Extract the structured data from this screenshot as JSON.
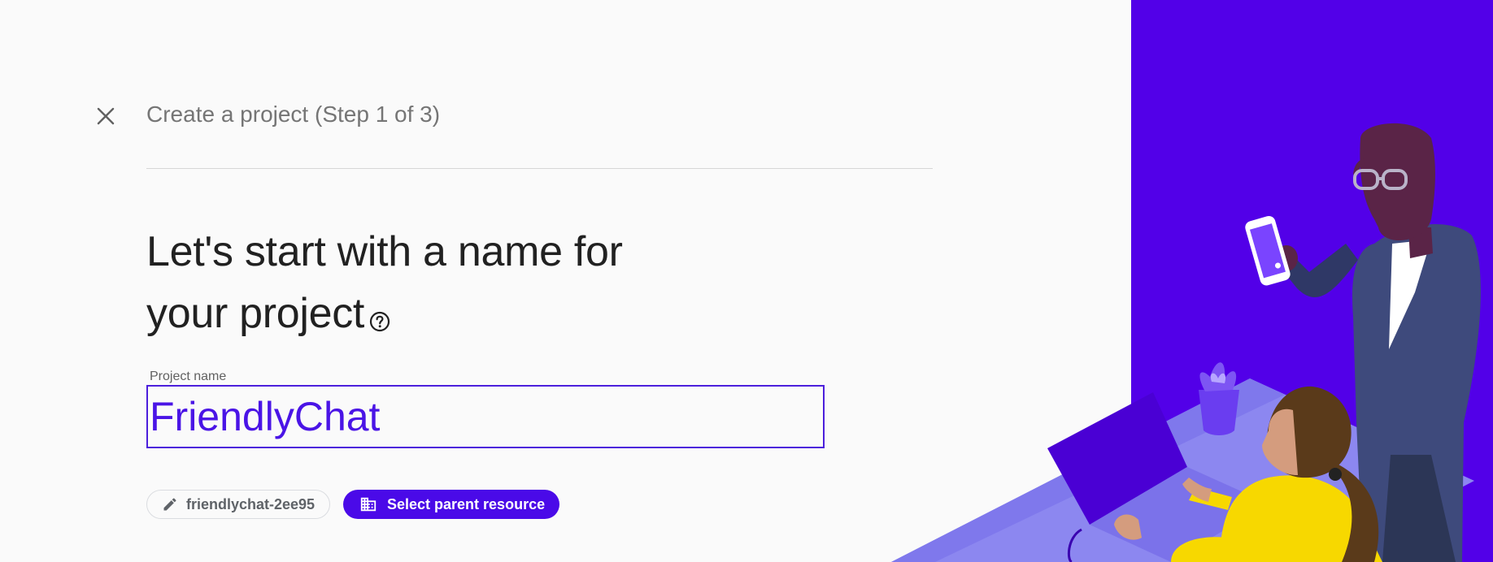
{
  "header": {
    "close_icon": "close-icon",
    "title": "Create a project (Step 1 of 3)"
  },
  "main": {
    "headline_line1": "Let's start with a name for",
    "headline_line2": "your project",
    "help_icon": "help-circle-icon",
    "project_name_label": "Project name",
    "project_name_value": "FriendlyChat"
  },
  "chips": {
    "project_id_icon": "pencil-icon",
    "project_id": "friendlychat-2ee95",
    "parent_icon": "building-icon",
    "parent_label": "Select parent resource"
  },
  "colors": {
    "accent": "#4a0ae8",
    "panel": "#5200e8"
  }
}
